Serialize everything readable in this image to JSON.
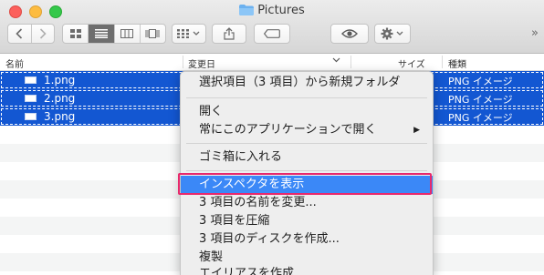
{
  "window": {
    "title": "Pictures",
    "folder_icon": "folder-icon"
  },
  "toolbar": {
    "nav": [
      "back-icon",
      "forward-icon"
    ],
    "view_modes": [
      "icon-view-icon",
      "list-view-icon",
      "column-view-icon",
      "coverflow-view-icon"
    ],
    "active_view": "list-view-icon",
    "arrange_icon": "arrange-grid-icon",
    "share_icon": "share-icon",
    "tag_icon": "tag-icon",
    "quicklook_icon": "eye-icon",
    "action_icon": "gear-icon",
    "more": "»"
  },
  "columns": {
    "name": "名前",
    "date": "変更日",
    "size": "サイズ",
    "kind": "種類"
  },
  "files": [
    {
      "name": "1.png",
      "kind": "PNG イメージ"
    },
    {
      "name": "2.png",
      "kind": "PNG イメージ"
    },
    {
      "name": "3.png",
      "kind": "PNG イメージ"
    }
  ],
  "context_menu": {
    "items": [
      "選択項目（3 項目）から新規フォルダ",
      "開く",
      "常にこのアプリケーションで開く",
      "ゴミ箱に入れる",
      "インスペクタを表示",
      "3 項目の名前を変更...",
      "3 項目を圧縮",
      "3 項目のディスクを作成...",
      "複製",
      "エイリアスを作成"
    ],
    "highlighted": "インスペクタを表示",
    "submenu_arrow": "▶"
  },
  "colors": {
    "selection": "#1357d2",
    "menu_highlight": "#3b88f7",
    "annotation_frame": "#e8296c"
  }
}
